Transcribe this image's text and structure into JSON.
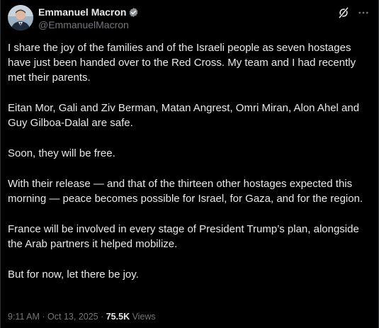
{
  "author": {
    "display_name": "Emmanuel Macron",
    "handle": "@EmmanuelMacron",
    "verified": true
  },
  "icons": {
    "verified": "verified-badge-icon",
    "grok": "grok-icon",
    "more": "more-icon"
  },
  "colors": {
    "background": "#000000",
    "text": "#e7e9ea",
    "muted": "#71767b",
    "verified_badge": "#1d9bf0"
  },
  "post": {
    "paragraphs": [
      "I share the joy of the families and of the Israeli people as seven hostages have just been handed over to the Red Cross. My team and I had recently met their parents.",
      "Eitan Mor, Gali and Ziv Berman, Matan Angrest, Omri Miran, Alon Ahel and Guy Gilboa-Dalal are safe.",
      "Soon, they will be free.",
      "With their release — and that of the thirteen other hostages expected this morning — peace becomes possible for Israel, for Gaza, and for the region.",
      "France will be involved in every stage of President Trump’s plan, alongside the Arab partners it helped mobilize.",
      "But for now, let there be joy."
    ]
  },
  "meta": {
    "time": "9:11 AM",
    "separator": " · ",
    "date": "Oct 13, 2025",
    "views_count": "75.5K",
    "views_label": " Views"
  }
}
